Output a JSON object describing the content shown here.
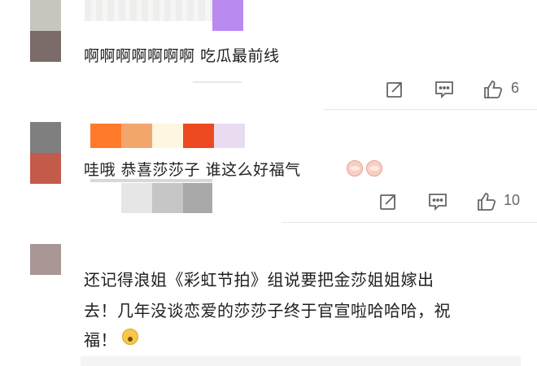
{
  "comments": [
    {
      "text": "啊啊啊啊啊啊啊 吃瓜最前线",
      "like_count": "6",
      "avatar_color": "#7a6b68",
      "avatar_top_color": "#c6c6bf",
      "name_color": "#b98bf0"
    },
    {
      "text": "哇哦 恭喜莎莎子 谁这么好福气",
      "like_count": "10",
      "avatar_color": "#c45a4a",
      "avatar_top_color": "#7f7f7f",
      "name_palette": [
        "#ff7a2a",
        "#f3a66b",
        "#fff6df",
        "#ee4a21",
        "#e9dcf1"
      ],
      "sub_palette": [
        "#e6e6e6",
        "#c6c6c6",
        "#a9a9a9"
      ]
    },
    {
      "text_line1": "还记得浪姐《彩虹节拍》组说要把金莎姐姐嫁出",
      "text_line2": "去！几年没谈恋爱的莎莎子终于官宣啦哈哈哈，祝",
      "text_line3": "福！",
      "avatar_color": "#a89794"
    }
  ],
  "icons": {
    "share": "share-icon",
    "comment": "comment-icon",
    "like": "thumbs-up-icon",
    "emoji_blush": "blush-emoji-icon",
    "emoji_gasp": "gasp-emoji-icon"
  }
}
